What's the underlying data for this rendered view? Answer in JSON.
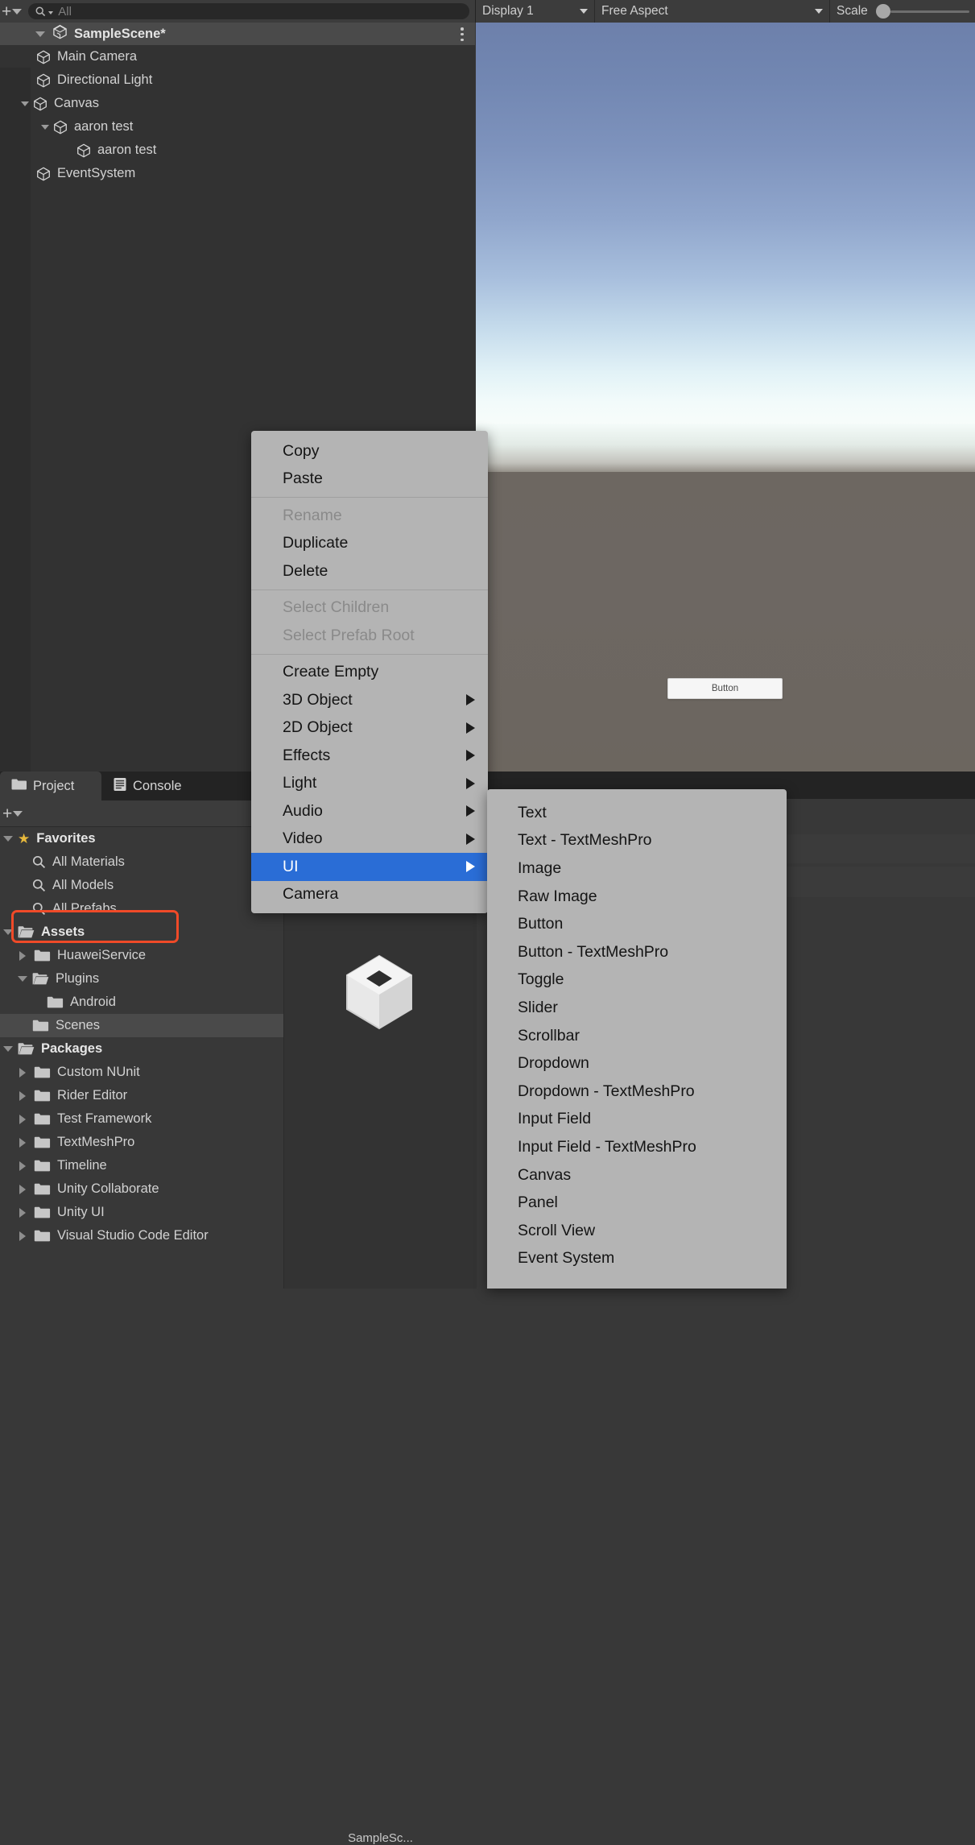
{
  "app": "Unity Editor",
  "hierarchy_toolbar": {
    "add_icon": "plus-icon",
    "dropdown_icon": "chevron-down-icon",
    "search_icon": "search-icon",
    "search_value": "",
    "search_placeholder": "All"
  },
  "game_toolbar": {
    "display": "Display 1",
    "aspect": "Free Aspect",
    "scale_label": "Scale",
    "scale_value": 1
  },
  "hierarchy": {
    "scene_name": "SampleScene*",
    "scene_icon": "unity-scene-icon",
    "menu_icon": "kebab-menu-icon",
    "items": [
      {
        "label": "Main Camera",
        "depth": 1,
        "expandable": false,
        "expanded": false
      },
      {
        "label": "Directional Light",
        "depth": 1,
        "expandable": false,
        "expanded": false
      },
      {
        "label": "Canvas",
        "depth": 1,
        "expandable": true,
        "expanded": true
      },
      {
        "label": "aaron test",
        "depth": 2,
        "expandable": true,
        "expanded": true
      },
      {
        "label": "aaron test",
        "depth": 3,
        "expandable": false,
        "expanded": false
      },
      {
        "label": "EventSystem",
        "depth": 1,
        "expandable": false,
        "expanded": false
      }
    ]
  },
  "game_view": {
    "button_label": "Button",
    "sky_top_color": "#6d80ab",
    "sky_bottom_color": "#f2fbfa",
    "ground_color": "#6d6761"
  },
  "project": {
    "tabs": [
      {
        "label": "Project",
        "icon": "folder-icon",
        "active": true
      },
      {
        "label": "Console",
        "icon": "console-icon",
        "active": false
      }
    ],
    "toolbar": {
      "add_icon": "plus-icon",
      "dropdown_icon": "chevron-down-icon"
    },
    "tree": [
      {
        "label": "Favorites",
        "depth": 0,
        "icon": "star-icon",
        "twisty": "down",
        "bold": true,
        "selected": false
      },
      {
        "label": "All Materials",
        "depth": 1,
        "icon": "search-icon",
        "twisty": "none",
        "bold": false,
        "selected": false
      },
      {
        "label": "All Models",
        "depth": 1,
        "icon": "search-icon",
        "twisty": "none",
        "bold": false,
        "selected": false
      },
      {
        "label": "All Prefabs",
        "depth": 1,
        "icon": "search-icon",
        "twisty": "none",
        "bold": false,
        "selected": false
      },
      {
        "label": "Assets",
        "depth": 0,
        "icon": "folder-open-icon",
        "twisty": "down",
        "bold": true,
        "selected": false
      },
      {
        "label": "HuaweiService",
        "depth": 1,
        "icon": "folder-icon",
        "twisty": "right",
        "bold": false,
        "selected": false
      },
      {
        "label": "Plugins",
        "depth": 1,
        "icon": "folder-open-icon",
        "twisty": "down",
        "bold": false,
        "selected": false
      },
      {
        "label": "Android",
        "depth": 2,
        "icon": "folder-icon",
        "twisty": "none",
        "bold": false,
        "selected": false
      },
      {
        "label": "Scenes",
        "depth": 1,
        "icon": "folder-icon",
        "twisty": "none",
        "bold": false,
        "selected": true
      },
      {
        "label": "Packages",
        "depth": 0,
        "icon": "folder-open-icon",
        "twisty": "down",
        "bold": true,
        "selected": false
      },
      {
        "label": "Custom NUnit",
        "depth": 1,
        "icon": "folder-icon",
        "twisty": "right",
        "bold": false,
        "selected": false
      },
      {
        "label": "Rider Editor",
        "depth": 1,
        "icon": "folder-icon",
        "twisty": "right",
        "bold": false,
        "selected": false
      },
      {
        "label": "Test Framework",
        "depth": 1,
        "icon": "folder-icon",
        "twisty": "right",
        "bold": false,
        "selected": false
      },
      {
        "label": "TextMeshPro",
        "depth": 1,
        "icon": "folder-icon",
        "twisty": "right",
        "bold": false,
        "selected": false
      },
      {
        "label": "Timeline",
        "depth": 1,
        "icon": "folder-icon",
        "twisty": "right",
        "bold": false,
        "selected": false
      },
      {
        "label": "Unity Collaborate",
        "depth": 1,
        "icon": "folder-icon",
        "twisty": "right",
        "bold": false,
        "selected": false
      },
      {
        "label": "Unity UI",
        "depth": 1,
        "icon": "folder-icon",
        "twisty": "right",
        "bold": false,
        "selected": false
      },
      {
        "label": "Visual Studio Code Editor",
        "depth": 1,
        "icon": "folder-icon",
        "twisty": "right",
        "bold": false,
        "selected": false
      }
    ],
    "asset_preview_name": "SampleSc..."
  },
  "context_menu": {
    "items": [
      {
        "label": "Copy",
        "type": "item",
        "disabled": false,
        "submenu": false,
        "highlighted": false
      },
      {
        "label": "Paste",
        "type": "item",
        "disabled": false,
        "submenu": false,
        "highlighted": false
      },
      {
        "label": "",
        "type": "separator"
      },
      {
        "label": "Rename",
        "type": "item",
        "disabled": true,
        "submenu": false,
        "highlighted": false
      },
      {
        "label": "Duplicate",
        "type": "item",
        "disabled": false,
        "submenu": false,
        "highlighted": false
      },
      {
        "label": "Delete",
        "type": "item",
        "disabled": false,
        "submenu": false,
        "highlighted": false
      },
      {
        "label": "",
        "type": "separator"
      },
      {
        "label": "Select Children",
        "type": "item",
        "disabled": true,
        "submenu": false,
        "highlighted": false
      },
      {
        "label": "Select Prefab Root",
        "type": "item",
        "disabled": true,
        "submenu": false,
        "highlighted": false
      },
      {
        "label": "",
        "type": "separator"
      },
      {
        "label": "Create Empty",
        "type": "item",
        "disabled": false,
        "submenu": false,
        "highlighted": false
      },
      {
        "label": "3D Object",
        "type": "item",
        "disabled": false,
        "submenu": true,
        "highlighted": false
      },
      {
        "label": "2D Object",
        "type": "item",
        "disabled": false,
        "submenu": true,
        "highlighted": false
      },
      {
        "label": "Effects",
        "type": "item",
        "disabled": false,
        "submenu": true,
        "highlighted": false
      },
      {
        "label": "Light",
        "type": "item",
        "disabled": false,
        "submenu": true,
        "highlighted": false
      },
      {
        "label": "Audio",
        "type": "item",
        "disabled": false,
        "submenu": true,
        "highlighted": false
      },
      {
        "label": "Video",
        "type": "item",
        "disabled": false,
        "submenu": true,
        "highlighted": false
      },
      {
        "label": "UI",
        "type": "item",
        "disabled": false,
        "submenu": true,
        "highlighted": true
      },
      {
        "label": "Camera",
        "type": "item",
        "disabled": false,
        "submenu": false,
        "highlighted": false
      }
    ],
    "highlight_color": "#2a6dd6"
  },
  "ui_submenu": {
    "highlight_color": "#f04a28",
    "highlighted_item": "Button",
    "items": [
      {
        "label": "Text"
      },
      {
        "label": "Text - TextMeshPro"
      },
      {
        "label": "Image"
      },
      {
        "label": "Raw Image"
      },
      {
        "label": "Button"
      },
      {
        "label": "Button - TextMeshPro"
      },
      {
        "label": "Toggle"
      },
      {
        "label": "Slider"
      },
      {
        "label": "Scrollbar"
      },
      {
        "label": "Dropdown"
      },
      {
        "label": "Dropdown - TextMeshPro"
      },
      {
        "label": "Input Field"
      },
      {
        "label": "Input Field - TextMeshPro"
      },
      {
        "label": "Canvas"
      },
      {
        "label": "Panel"
      },
      {
        "label": "Scroll View"
      },
      {
        "label": "Event System"
      }
    ]
  }
}
